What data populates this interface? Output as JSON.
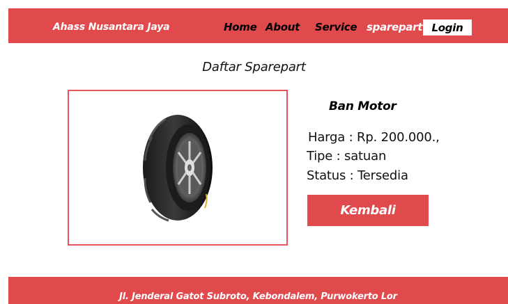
{
  "header": {
    "brand": "Ahass Nusantara Jaya",
    "nav": {
      "home": "Home",
      "about": "About",
      "service": "Service",
      "sparepart": "sparepart",
      "login": "Login"
    }
  },
  "main": {
    "title": "Daftar Sparepart",
    "product": {
      "image_icon": "motorcycle-tire-image",
      "name": "Ban Motor",
      "price": "Harga : Rp. 200.000.,",
      "type": "Tipe : satuan",
      "status": "Status : Tersedia"
    },
    "back_label": "Kembali"
  },
  "footer": {
    "address": "Jl. Jenderal Gatot Subroto, Kebondalem, Purwokerto Lor"
  },
  "colors": {
    "accent": "#e04a4d",
    "frame_border": "#e85659"
  }
}
